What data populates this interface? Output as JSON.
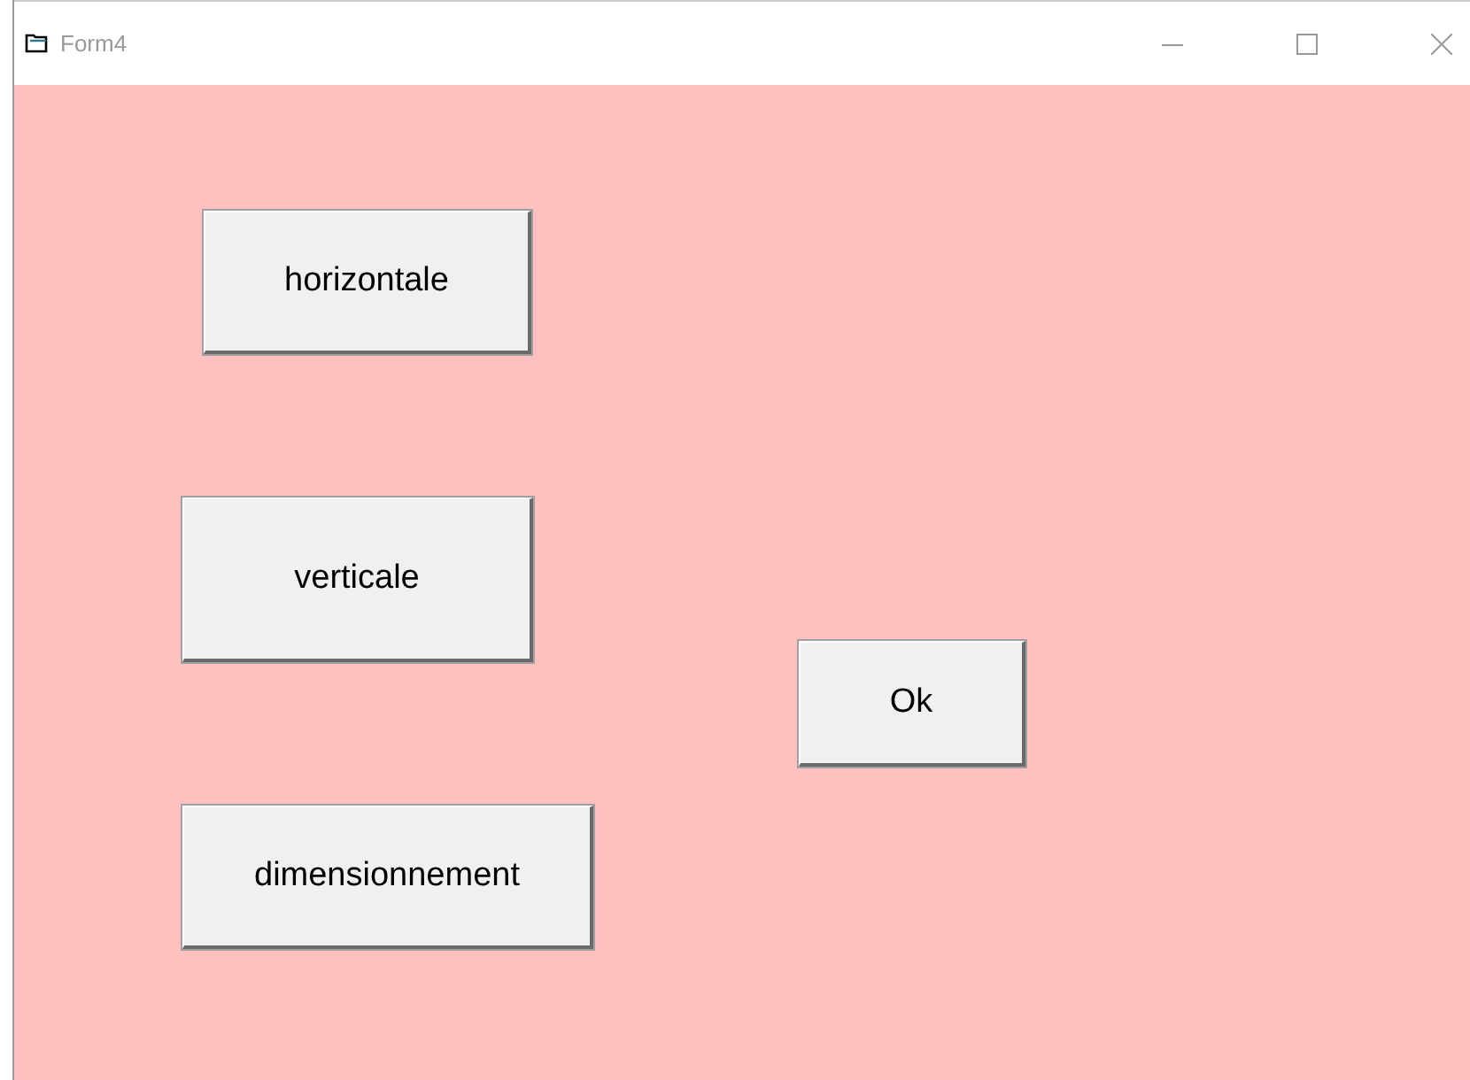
{
  "window": {
    "title": "Form4"
  },
  "buttons": [
    {
      "label": "horizontale"
    },
    {
      "label": "verticale"
    },
    {
      "label": "Ok"
    },
    {
      "label": "dimensionnement"
    }
  ]
}
